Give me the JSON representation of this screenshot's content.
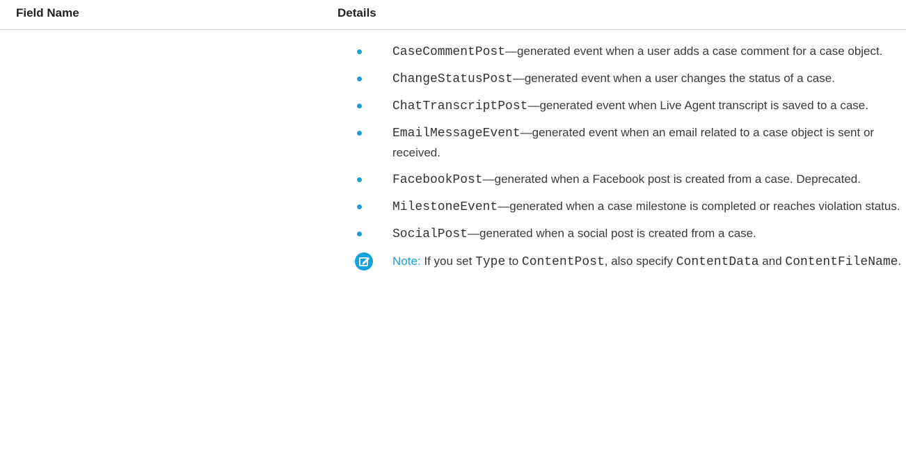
{
  "table": {
    "headers": {
      "field_name": "Field Name",
      "details": "Details"
    }
  },
  "details": {
    "items": [
      {
        "code": "CaseCommentPost",
        "separator": "—",
        "text": "generated event when a user adds a case comment for a case object."
      },
      {
        "code": "ChangeStatusPost",
        "separator": "—",
        "text": "generated event when a user changes the status of a case."
      },
      {
        "code": "ChatTranscriptPost",
        "separator": "—",
        "text": "generated event when Live Agent transcript is saved to a case."
      },
      {
        "code": "EmailMessageEvent",
        "separator": "—",
        "text": "generated event when an email related to a case object is sent or received."
      },
      {
        "code": "FacebookPost",
        "separator": "—",
        "text": "generated when a Facebook post is created from a case. Deprecated."
      },
      {
        "code": "MilestoneEvent",
        "separator": "—",
        "text": "generated when a case milestone is completed or reaches violation status."
      },
      {
        "code": "SocialPost",
        "separator": "—",
        "text": "generated when a social post is created from a case."
      }
    ],
    "note": {
      "icon": "edit-note-icon",
      "label": "Note:",
      "text_1": "If you set ",
      "code_1": "Type",
      "text_2": " to ",
      "code_2": "ContentPost",
      "text_3": ", also specify ",
      "code_3": "ContentData",
      "text_4": " and ",
      "code_4": "ContentFileName",
      "text_5": "."
    }
  },
  "colors": {
    "accent": "#16a0dc",
    "header_border": "#d4d4d4",
    "text": "#3a3a3a"
  }
}
